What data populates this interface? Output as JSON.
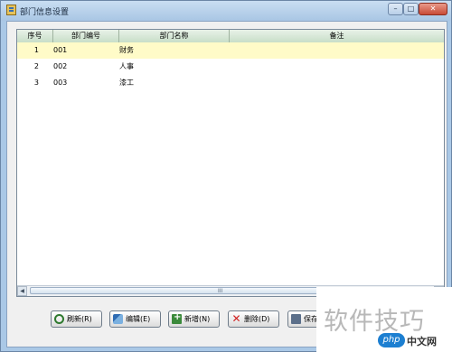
{
  "window": {
    "title": "部门信息设置",
    "controls": {
      "minimize": "–",
      "maximize": "□",
      "close": "✕"
    }
  },
  "grid": {
    "columns": [
      "序号",
      "部门编号",
      "部门名称",
      "备注"
    ],
    "rows": [
      {
        "index": "1",
        "code": "001",
        "name": "财务",
        "note": ""
      },
      {
        "index": "2",
        "code": "002",
        "name": "人事",
        "note": ""
      },
      {
        "index": "3",
        "code": "003",
        "name": "漆工",
        "note": ""
      }
    ],
    "selected_row": 1,
    "scroll_grip": "III"
  },
  "toolbar": {
    "refresh_label": "刷新(R)",
    "edit_label": "编辑(E)",
    "new_label": "新增(N)",
    "delete_label": "删除(D)",
    "save_label": "保存"
  },
  "watermark": {
    "text": "软件技巧",
    "logo": "php",
    "site": "中文网"
  },
  "colors": {
    "titlebar": "#aac8e6",
    "header": "#c8dec8",
    "selected_row": "#fffbc8"
  }
}
